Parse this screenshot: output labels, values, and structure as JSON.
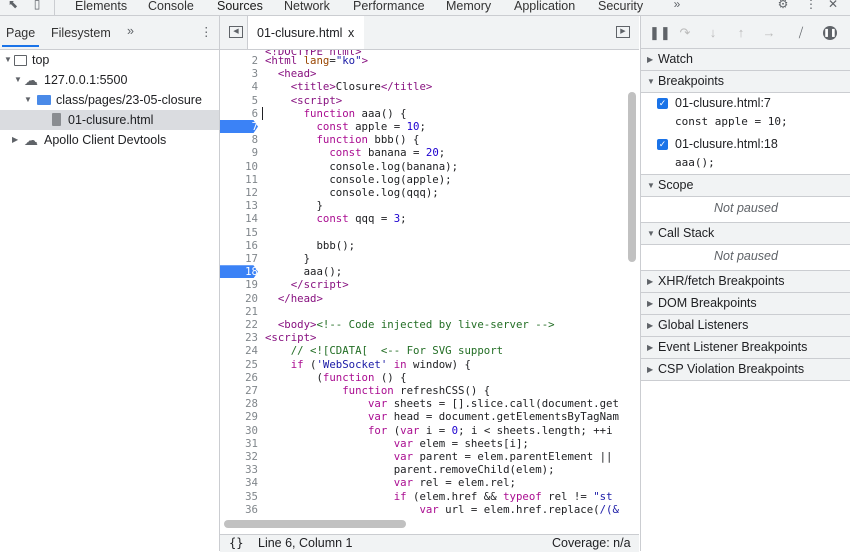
{
  "panels": [
    "Elements",
    "Console",
    "Sources",
    "Network",
    "Performance",
    "Memory",
    "Application",
    "Security"
  ],
  "navigator": {
    "tabs": [
      "Page",
      "Filesystem"
    ],
    "tree": [
      {
        "label": "top"
      },
      {
        "label": "127.0.0.1:5500"
      },
      {
        "label": "class/pages/23-05-closure"
      },
      {
        "label": "01-clusure.html"
      },
      {
        "label": "Apollo Client Devtools"
      }
    ]
  },
  "editor": {
    "tab_label": "01-clusure.html",
    "tab_close": "x",
    "status_position": "Line 6, Column 1",
    "status_coverage": "Coverage: n/a",
    "status_braces": "{}",
    "line_numbers": [
      "2",
      "3",
      "4",
      "5",
      "6",
      "7",
      "8",
      "9",
      "10",
      "11",
      "12",
      "13",
      "14",
      "15",
      "16",
      "17",
      "18",
      "19",
      "20",
      "21",
      "22",
      "23",
      "24",
      "25",
      "26",
      "27",
      "28",
      "29",
      "30",
      "31",
      "32",
      "33",
      "34",
      "35",
      "36"
    ],
    "breakpoint_lines": [
      "7",
      "18"
    ]
  },
  "debugger": {
    "sections": {
      "watch": "Watch",
      "breakpoints": "Breakpoints",
      "scope": "Scope",
      "call_stack": "Call Stack",
      "xhr": "XHR/fetch Breakpoints",
      "dom": "DOM Breakpoints",
      "global": "Global Listeners",
      "event": "Event Listener Breakpoints",
      "csp": "CSP Violation Breakpoints"
    },
    "breakpoints": [
      {
        "file": "01-clusure.html:7",
        "code": "const apple = 10;"
      },
      {
        "file": "01-clusure.html:18",
        "code": "aaa();"
      }
    ],
    "scope_status": "Not paused",
    "callstack_status": "Not paused"
  },
  "colors": {
    "accent": "#1a73e8",
    "breakpoint": "#3b82f6"
  }
}
